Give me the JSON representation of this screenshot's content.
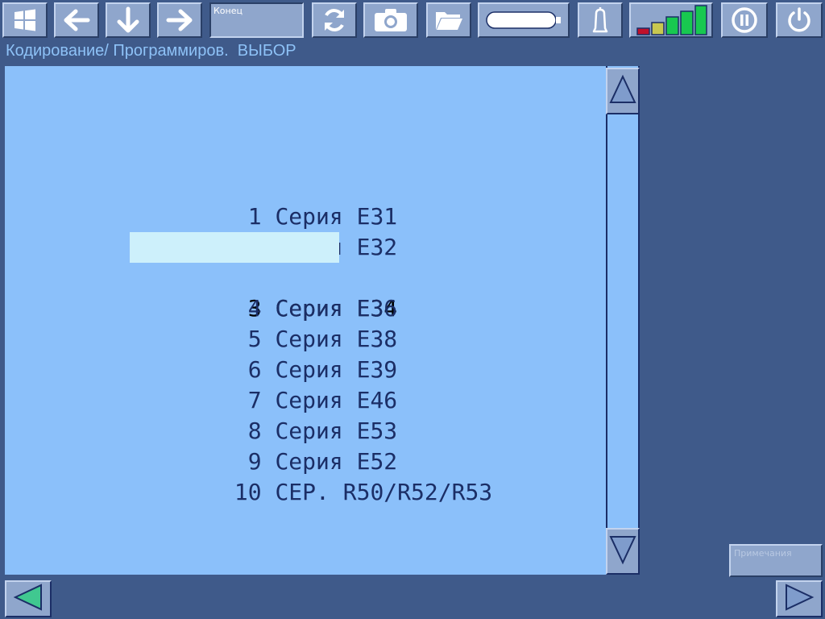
{
  "toolbar": {
    "konec_label": "Конец"
  },
  "breadcrumb": {
    "path": "Кодирование/ Программиров.",
    "mode": "ВЫБОР"
  },
  "list": {
    "items": [
      {
        "num": " 1",
        "label": "Серия E31",
        "selected": false
      },
      {
        "num": " 2",
        "label": "Серия E32",
        "selected": false
      },
      {
        "num": " 3",
        "label": "Серия E34",
        "selected": true
      },
      {
        "num": " 4",
        "label": "Серия E36",
        "selected": false
      },
      {
        "num": " 5",
        "label": "Серия E38",
        "selected": false
      },
      {
        "num": " 6",
        "label": "Серия E39",
        "selected": false
      },
      {
        "num": " 7",
        "label": "Серия E46",
        "selected": false
      },
      {
        "num": " 8",
        "label": "Серия E53",
        "selected": false
      },
      {
        "num": " 9",
        "label": "Серия E52",
        "selected": false
      },
      {
        "num": "10",
        "label": "СЕР. R50/R52/R53",
        "selected": false
      }
    ]
  },
  "notes": {
    "label": "Примечания"
  },
  "colors": {
    "background": "#3f5a8a",
    "panel": "#8bc0fa",
    "button": "#8fa6cc",
    "selection": "#cdf0fb",
    "text": "#1b2e66",
    "breadcrumb": "#8ec2f7",
    "signal_red": "#c0102a",
    "signal_yellow": "#c8c850",
    "signal_green": "#18c850"
  },
  "icons": {
    "windows": "windows-icon",
    "back": "arrow-left-icon",
    "down": "arrow-down-icon",
    "forward": "arrow-right-icon",
    "refresh": "refresh-icon",
    "camera": "camera-icon",
    "folder": "folder-open-icon",
    "battery": "battery-icon",
    "bell": "bell-icon",
    "signal": "signal-strength-icon",
    "pause": "pause-icon",
    "power": "power-icon"
  }
}
